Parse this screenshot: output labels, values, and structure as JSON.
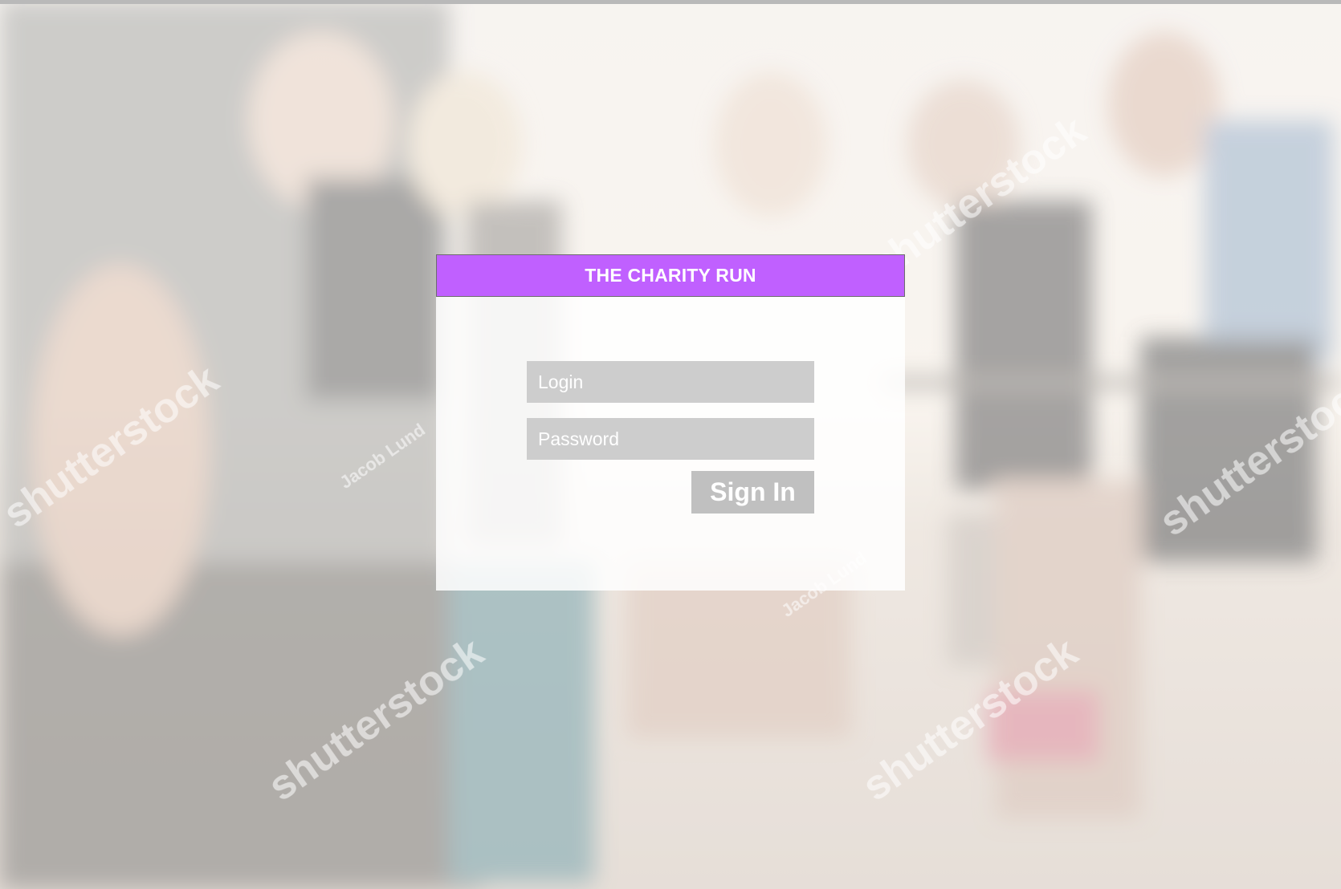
{
  "app": {
    "title": "THE CHARITY RUN"
  },
  "form": {
    "login_placeholder": "Login",
    "login_value": "",
    "password_placeholder": "Password",
    "password_value": "",
    "signin_label": "Sign In"
  },
  "background": {
    "description_icon": "runners-photo",
    "watermark_brand": "shutterstock",
    "watermark_author": "Jacob Lund"
  },
  "colors": {
    "header_bg": "#c060ff",
    "header_text": "#ffffff",
    "field_bg": "#cdcdcd",
    "button_bg": "#c0c0c0"
  }
}
